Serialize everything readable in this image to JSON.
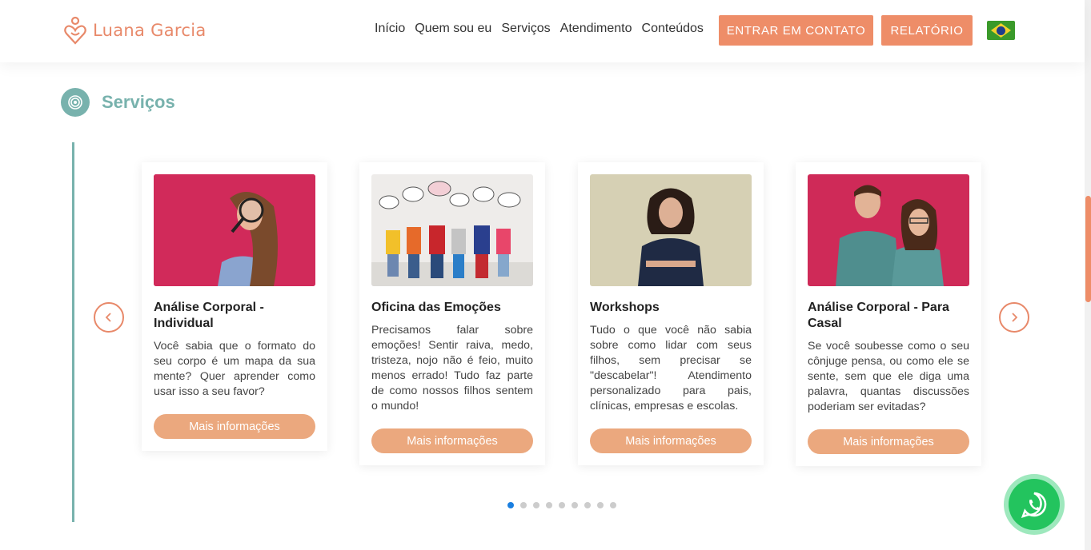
{
  "brand": {
    "name": "Luana Garcia",
    "accent": "#ee8d68",
    "teal": "#78b2ad"
  },
  "nav": {
    "items": [
      {
        "label": "Início"
      },
      {
        "label": "Quem sou eu"
      },
      {
        "label": "Serviços"
      },
      {
        "label": "Atendimento"
      },
      {
        "label": "Conteúdos"
      }
    ],
    "contact_label": "ENTRAR EM CONTATO",
    "report_label": "RELATÓRIO",
    "language_icon": "brazil-flag-icon"
  },
  "section": {
    "title": "Serviços",
    "icon": "target-icon"
  },
  "carousel": {
    "prev_icon": "chevron-left-icon",
    "next_icon": "chevron-right-icon",
    "cards": [
      {
        "title": "Análise Corporal - Individual",
        "text": "Você sabia que o formato do seu corpo é um mapa da sua mente? Quer aprender como usar isso a seu favor?",
        "button": "Mais informações"
      },
      {
        "title": "Oficina das Emoções",
        "text": "Precisamos falar sobre emoções! Sentir raiva, medo, tristeza, nojo não é feio, muito menos errado! Tudo faz parte de como nossos filhos sentem o mundo!",
        "button": "Mais informações"
      },
      {
        "title": "Workshops",
        "text": "Tudo o que você não sabia sobre como lidar com seus filhos, sem precisar se \"descabelar\"! Atendimento personalizado para pais, clínicas, empresas e escolas.",
        "button": "Mais informações"
      },
      {
        "title": "Análise Corporal - Para Casal",
        "text": "Se você soubesse como o seu cônjuge pensa, ou como ele se sente, sem que ele diga uma palavra, quantas discussões poderiam ser evitadas?",
        "button": "Mais informações"
      }
    ],
    "page_count": 9,
    "active_page": 1
  },
  "floating": {
    "whatsapp_icon": "whatsapp-icon"
  }
}
